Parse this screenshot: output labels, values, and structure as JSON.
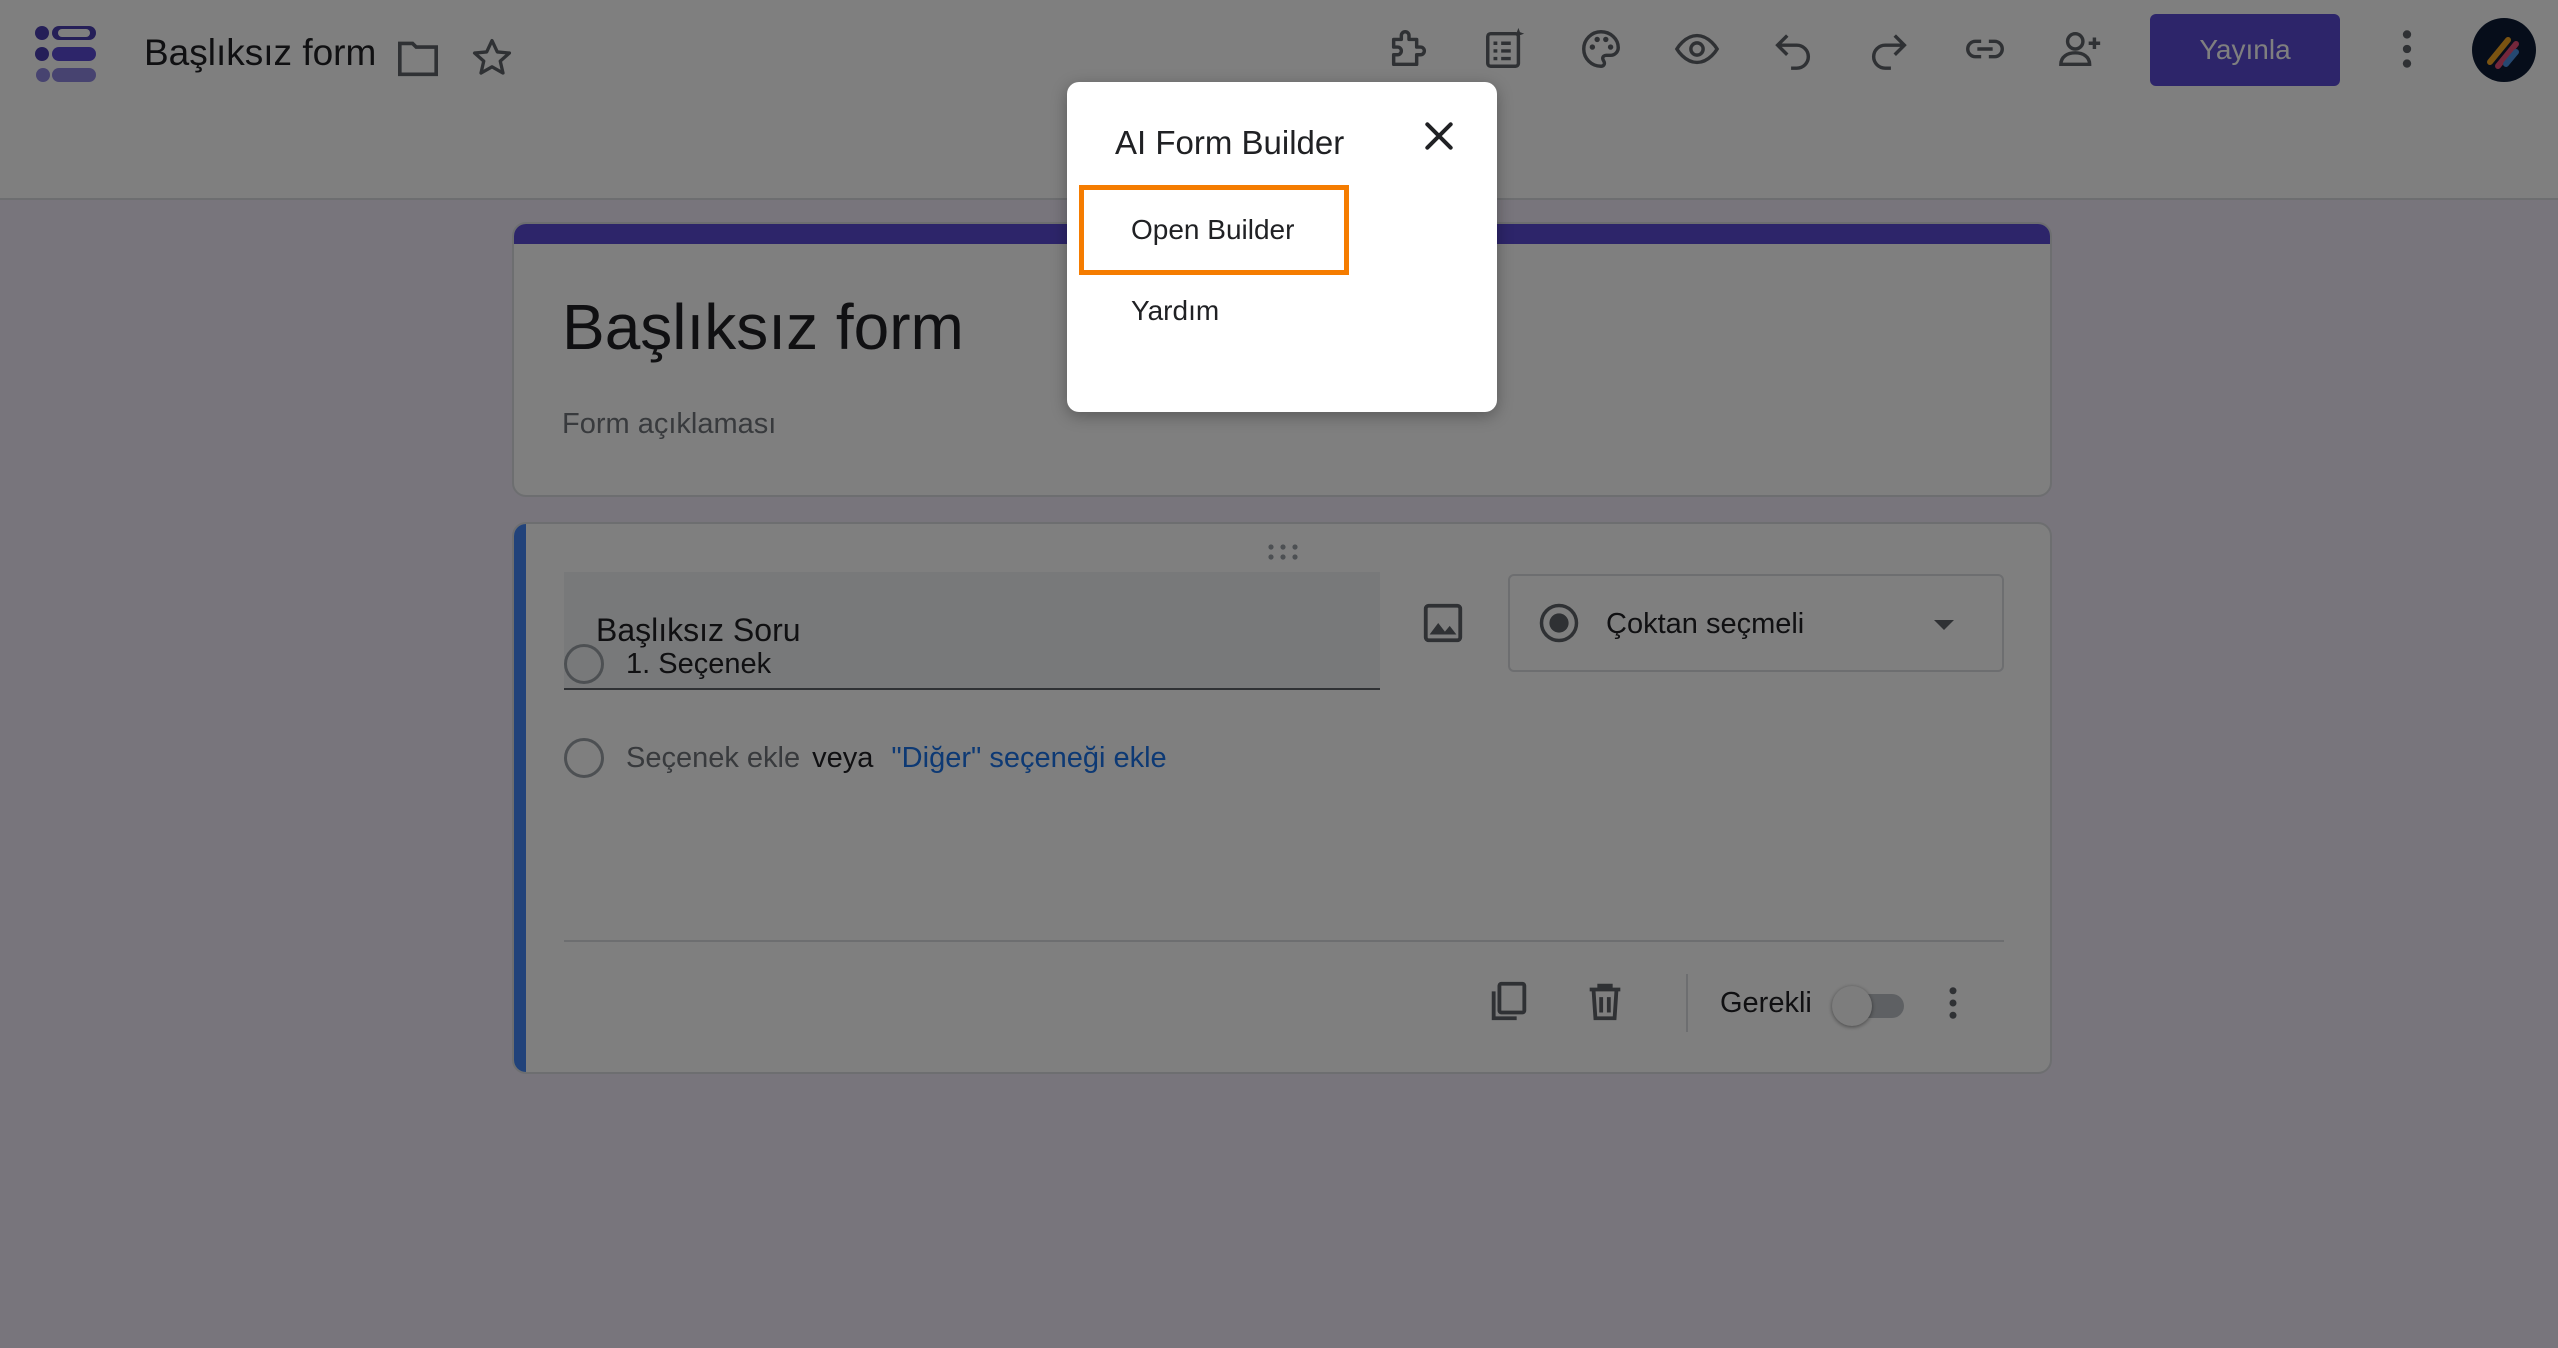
{
  "header": {
    "doc_title": "Başlıksız form",
    "publish_label": "Yayınla",
    "toolbar_icons": [
      "puzzle-icon",
      "ai-sheet-icon",
      "palette-icon",
      "preview-eye-icon",
      "undo-icon",
      "redo-icon",
      "link-icon",
      "add-collaborator-icon"
    ]
  },
  "form": {
    "title": "Başlıksız form",
    "description": "Form açıklaması"
  },
  "question": {
    "title": "Başlıksız Soru",
    "type": "Çoktan seçmeli",
    "options": [
      "1. Seçenek"
    ],
    "add_option": "Seçenek ekle",
    "or_text": "veya",
    "add_other": "\"Diğer\" seçeneği ekle",
    "required_label": "Gerekli",
    "required_on": false
  },
  "popup": {
    "title": "AI Form Builder",
    "items": [
      "Open Builder",
      "Yardım"
    ],
    "highlighted_item": "Open Builder"
  },
  "colors": {
    "accent": "#5b4bd5",
    "question_accent": "#4285f4",
    "link": "#1a73e8",
    "highlight": "#f57c00"
  }
}
